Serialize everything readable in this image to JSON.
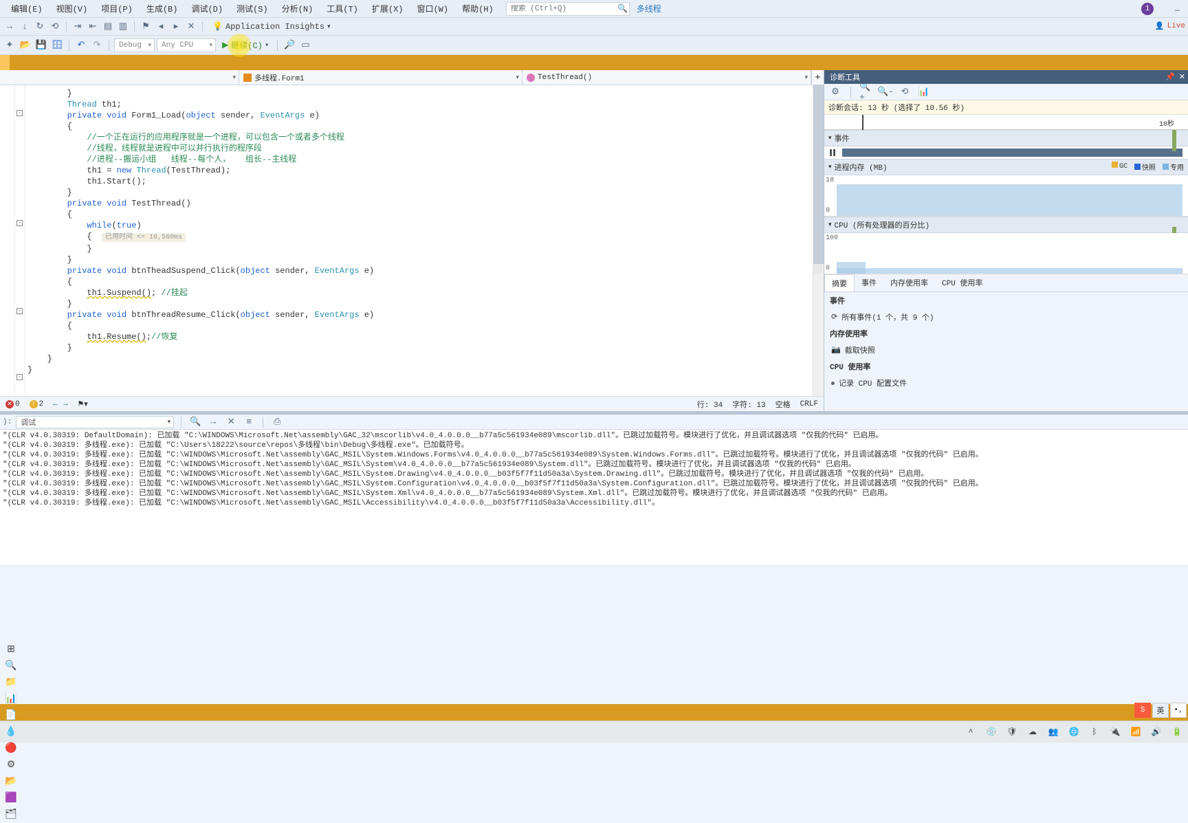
{
  "menu": {
    "items": [
      "编辑(E)",
      "视图(V)",
      "项目(P)",
      "生成(B)",
      "调试(D)",
      "测试(S)",
      "分析(N)",
      "工具(T)",
      "扩展(X)",
      "窗口(W)",
      "帮助(H)"
    ],
    "search_placeholder": "搜索 (Ctrl+Q)",
    "link": "多线程",
    "user_initial": "1"
  },
  "toolbar": {
    "app_insights": "Application Insights",
    "live": "Live",
    "config": "Debug",
    "platform": "Any CPU",
    "run_label": "继续(C)"
  },
  "nav": {
    "project": "多线程.Form1",
    "member": "TestThread()"
  },
  "code": {
    "lines": [
      {
        "t": "        }",
        "cls": ""
      },
      {
        "t": "        Thread th1;",
        "seg": [
          [
            "        ",
            ""
          ],
          [
            "Thread",
            "type"
          ],
          [
            " th1;",
            ""
          ]
        ]
      },
      {
        "t": "        private void Form1_Load(object sender, EventArgs e)",
        "seg": [
          [
            "        ",
            ""
          ],
          [
            "private void",
            "kw"
          ],
          [
            " Form1_Load(",
            ""
          ],
          [
            "object",
            "kw"
          ],
          [
            " sender, ",
            ""
          ],
          [
            "EventArgs",
            "type"
          ],
          [
            " e)",
            ""
          ]
        ]
      },
      {
        "t": "        {",
        "cls": ""
      },
      {
        "t": "            //一个正在运行的应用程序就是一个进程，可以包含一个或者多个线程",
        "cls": "cmt"
      },
      {
        "t": "            //线程，线程就是进程中可以并行执行的程序段",
        "cls": "cmt"
      },
      {
        "t": "            //进程--搬运小组   线程--每个人，   组长--主线程",
        "cls": "cmt"
      },
      {
        "t": "",
        "cls": ""
      },
      {
        "t": "            th1 = new Thread(TestThread);",
        "seg": [
          [
            "            th1 = ",
            ""
          ],
          [
            "new",
            "kw"
          ],
          [
            " ",
            ""
          ],
          [
            "Thread",
            "type"
          ],
          [
            "(TestThread);",
            ""
          ]
        ]
      },
      {
        "t": "            th1.Start();",
        "cls": ""
      },
      {
        "t": "        }",
        "cls": ""
      },
      {
        "t": "",
        "cls": ""
      },
      {
        "t": "        private void TestThread()",
        "seg": [
          [
            "        ",
            ""
          ],
          [
            "private void",
            "kw"
          ],
          [
            " TestThread()",
            ""
          ]
        ]
      },
      {
        "t": "        {",
        "cls": ""
      },
      {
        "t": "            while(true)",
        "seg": [
          [
            "            ",
            ""
          ],
          [
            "while",
            "kw"
          ],
          [
            "(",
            ""
          ],
          [
            "true",
            "kw"
          ],
          [
            ")",
            ""
          ]
        ]
      },
      {
        "t": "            {",
        "cls": "",
        "hint": "已用时间 <= 10,560ms"
      },
      {
        "t": "",
        "cls": ""
      },
      {
        "t": "            }",
        "cls": ""
      },
      {
        "t": "        }",
        "cls": ""
      },
      {
        "t": "",
        "cls": ""
      },
      {
        "t": "        private void btnTheadSuspend_Click(object sender, EventArgs e)",
        "seg": [
          [
            "        ",
            ""
          ],
          [
            "private void",
            "kw"
          ],
          [
            " btnTheadSuspend_Click(",
            ""
          ],
          [
            "object",
            "kw"
          ],
          [
            " sender, ",
            ""
          ],
          [
            "EventArgs",
            "type"
          ],
          [
            " e)",
            ""
          ]
        ]
      },
      {
        "t": "        {",
        "cls": ""
      },
      {
        "t": "            th1.Suspend(); //挂起",
        "seg": [
          [
            "            ",
            ""
          ],
          [
            "th1.Suspend()",
            "underline"
          ],
          [
            "; ",
            ""
          ],
          [
            "//挂起",
            "cmt"
          ]
        ]
      },
      {
        "t": "        }",
        "cls": ""
      },
      {
        "t": "",
        "cls": ""
      },
      {
        "t": "        private void btnThreadResume_Click(object sender, EventArgs e)",
        "seg": [
          [
            "        ",
            ""
          ],
          [
            "private void",
            "kw"
          ],
          [
            " btnThreadResume_Click(",
            ""
          ],
          [
            "object",
            "kw"
          ],
          [
            " sender, ",
            ""
          ],
          [
            "EventArgs",
            "type"
          ],
          [
            " e)",
            ""
          ]
        ]
      },
      {
        "t": "        {",
        "cls": ""
      },
      {
        "t": "            th1.Resume();//恢复",
        "seg": [
          [
            "            ",
            ""
          ],
          [
            "th1.Resume()",
            "underline"
          ],
          [
            ";",
            ""
          ],
          [
            "//恢复",
            "cmt"
          ]
        ]
      },
      {
        "t": "        }",
        "cls": ""
      },
      {
        "t": "    }",
        "cls": ""
      },
      {
        "t": "}",
        "cls": ""
      }
    ]
  },
  "editor_status": {
    "errors": "0",
    "warnings": "2",
    "line": "行: 34",
    "col": "字符: 13",
    "tabs": "空格",
    "eol": "CRLF"
  },
  "diag": {
    "title": "诊断工具",
    "session": "诊断会话: 13 秒 (选择了 10.56 秒)",
    "ruler_tick": "10秒",
    "events_hdr": "事件",
    "mem_hdr": "进程内存 (MB)",
    "mem_legend": [
      [
        "GC",
        "#e8b131"
      ],
      [
        "快照",
        "#2a66d4"
      ],
      [
        "专用",
        "#7fb6e0"
      ]
    ],
    "mem_axis_max": "18",
    "mem_axis_min": "0",
    "cpu_hdr": "CPU (所有处理器的百分比)",
    "cpu_axis_max": "100",
    "cpu_axis_min": "0",
    "tabs": [
      "摘要",
      "事件",
      "内存使用率",
      "CPU 使用率"
    ],
    "active_tab": 0,
    "sec_events": "事件",
    "events_row": "所有事件(1 个，共 9 个)",
    "sec_mem": "内存使用率",
    "mem_row": "截取快照",
    "sec_cpu": "CPU 使用率",
    "cpu_row": "记录 CPU 配置文件"
  },
  "chart_data": [
    {
      "type": "area",
      "title": "进程内存 (MB)",
      "ylabel": "MB",
      "ylim": [
        0,
        18
      ],
      "x": [
        0,
        1,
        2,
        3,
        4,
        5,
        6,
        7,
        8,
        9,
        10,
        11,
        12,
        13
      ],
      "values": [
        0,
        14,
        14.5,
        14.5,
        14.5,
        14.5,
        14.5,
        14.5,
        14.5,
        14.5,
        14.5,
        14.5,
        14.5,
        14.5
      ]
    },
    {
      "type": "area",
      "title": "CPU (所有处理器的百分比)",
      "ylabel": "%",
      "ylim": [
        0,
        100
      ],
      "x": [
        0,
        1,
        2,
        3,
        4,
        5,
        6,
        7,
        8,
        9,
        10,
        11,
        12,
        13
      ],
      "values": [
        0,
        28,
        15,
        13,
        13,
        13,
        13,
        13,
        13,
        13,
        13,
        13,
        13,
        13
      ]
    }
  ],
  "output": {
    "source_label": "调试",
    "lines": [
      "\"(CLR v4.0.30319: DefaultDomain): 已加载 \"C:\\WINDOWS\\Microsoft.Net\\assembly\\GAC_32\\mscorlib\\v4.0_4.0.0.0__b77a5c561934e089\\mscorlib.dll\"。已跳过加载符号。模块进行了优化，并且调试器选项 \"仅我的代码\" 已启用。",
      "\"(CLR v4.0.30319: 多线程.exe): 已加载 \"C:\\Users\\18222\\source\\repos\\多线程\\bin\\Debug\\多线程.exe\"。已加载符号。",
      "\"(CLR v4.0.30319: 多线程.exe): 已加载 \"C:\\WINDOWS\\Microsoft.Net\\assembly\\GAC_MSIL\\System.Windows.Forms\\v4.0_4.0.0.0__b77a5c561934e089\\System.Windows.Forms.dll\"。已跳过加载符号。模块进行了优化，并且调试器选项 \"仅我的代码\" 已启用。",
      "\"(CLR v4.0.30319: 多线程.exe): 已加载 \"C:\\WINDOWS\\Microsoft.Net\\assembly\\GAC_MSIL\\System\\v4.0_4.0.0.0__b77a5c561934e089\\System.dll\"。已跳过加载符号。模块进行了优化，并且调试器选项 \"仅我的代码\" 已启用。",
      "\"(CLR v4.0.30319: 多线程.exe): 已加载 \"C:\\WINDOWS\\Microsoft.Net\\assembly\\GAC_MSIL\\System.Drawing\\v4.0_4.0.0.0__b03f5f7f11d50a3a\\System.Drawing.dll\"。已跳过加载符号。模块进行了优化，并且调试器选项 \"仅我的代码\" 已启用。",
      "\"(CLR v4.0.30319: 多线程.exe): 已加载 \"C:\\WINDOWS\\Microsoft.Net\\assembly\\GAC_MSIL\\System.Configuration\\v4.0_4.0.0.0__b03f5f7f11d50a3a\\System.Configuration.dll\"。已跳过加载符号。模块进行了优化，并且调试器选项 \"仅我的代码\" 已启用。",
      "\"(CLR v4.0.30319: 多线程.exe): 已加载 \"C:\\WINDOWS\\Microsoft.Net\\assembly\\GAC_MSIL\\System.Xml\\v4.0_4.0.0.0__b77a5c561934e089\\System.Xml.dll\"。已跳过加载符号。模块进行了优化，并且调试器选项 \"仅我的代码\" 已启用。",
      "\"(CLR v4.0.30319: 多线程.exe): 已加载 \"C:\\WINDOWS\\Microsoft.Net\\assembly\\GAC_MSIL\\Accessibility\\v4.0_4.0.0.0__b03f5f7f11d50a3a\\Accessibility.dll\"。"
    ]
  },
  "ime": {
    "sogou": "S",
    "lang": "英",
    "punct": "•,"
  },
  "taskbar": {
    "icons": [
      "⊞",
      "🔍",
      "📁",
      "📊",
      "📄",
      "💧",
      "🔴",
      "⚙",
      "📂",
      "🟪",
      "🗂"
    ]
  }
}
